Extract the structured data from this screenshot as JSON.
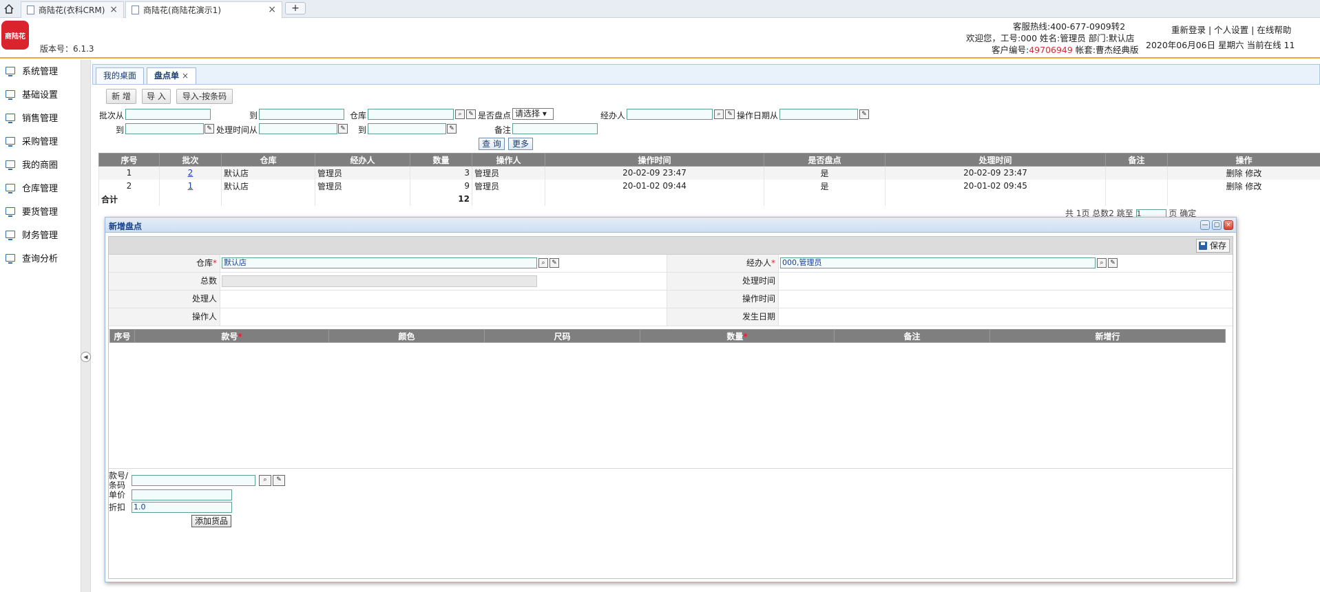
{
  "browser": {
    "tabs": [
      {
        "label": "商陆花(衣科CRM)"
      },
      {
        "label": "商陆花(商陆花演示1)"
      }
    ],
    "new_tab": "+"
  },
  "header": {
    "logo_text": "商陆花",
    "version": "版本号：6.1.3",
    "hotline": "客服热线:400-677-0909转2",
    "welcome": "欢迎您，工号:000 姓名:管理员 部门:默认店",
    "customer_prefix": "客户编号:",
    "customer_no": "49706949",
    "account": "帐套:曹杰经典版",
    "links": "重新登录 | 个人设置 | 在线帮助",
    "date_line": "2020年06月06日 星期六 当前在线 11"
  },
  "sidebar": {
    "items": [
      {
        "label": "系统管理"
      },
      {
        "label": "基础设置"
      },
      {
        "label": "销售管理"
      },
      {
        "label": "采购管理"
      },
      {
        "label": "我的商圈"
      },
      {
        "label": "仓库管理"
      },
      {
        "label": "要货管理"
      },
      {
        "label": "财务管理"
      },
      {
        "label": "查询分析"
      }
    ]
  },
  "content_tabs": [
    {
      "label": "我的桌面"
    },
    {
      "label": "盘点单",
      "close": "×"
    }
  ],
  "toolbar": {
    "add": "新 增",
    "import": "导 入",
    "import_barcode": "导入-按条码"
  },
  "filters": {
    "batch_from": "批次从",
    "to1": "到",
    "warehouse": "仓库",
    "is_check": "是否盘点",
    "is_check_value": "请选择",
    "handler": "经办人",
    "op_date_from": "操作日期从",
    "to2": "到",
    "process_time_from": "处理时间从",
    "to3": "到",
    "remark": "备注",
    "query": "查 询",
    "more": "更多"
  },
  "table": {
    "columns": [
      "序号",
      "批次",
      "仓库",
      "经办人",
      "数量",
      "操作人",
      "操作时间",
      "是否盘点",
      "处理时间",
      "备注",
      "操作"
    ],
    "rows": [
      {
        "no": "1",
        "batch": "2",
        "warehouse": "默认店",
        "handler": "管理员",
        "qty": "3",
        "operator": "管理员",
        "op_time": "20-02-09 23:47",
        "checked": "是",
        "process_time": "20-02-09 23:47",
        "remark": "",
        "actions": "删除 修改"
      },
      {
        "no": "2",
        "batch": "1",
        "warehouse": "默认店",
        "handler": "管理员",
        "qty": "9",
        "operator": "管理员",
        "op_time": "20-01-02 09:44",
        "checked": "是",
        "process_time": "20-01-02 09:45",
        "remark": "",
        "actions": "删除 修改"
      }
    ],
    "total_label": "合计",
    "total_qty": "12"
  },
  "pager": {
    "text": "共 1页 总数2 跳至",
    "page_input": "1",
    "suffix": "页 确定"
  },
  "dialog": {
    "title": "新增盘点",
    "save": "保存",
    "fields": {
      "warehouse_label": "仓库",
      "warehouse_value": "默认店",
      "handler_label": "经办人",
      "handler_value": "000,管理员",
      "total_label": "总数",
      "process_time_label": "处理时间",
      "processor_label": "处理人",
      "op_time_label": "操作时间",
      "operator_label": "操作人",
      "occur_date_label": "发生日期",
      "required_mark": "*"
    },
    "detail_columns": [
      "序号",
      "款号",
      "颜色",
      "尺码",
      "数量",
      "备注",
      "新增行"
    ],
    "bottom": {
      "style_barcode_label": "款号/条码",
      "price_label": "单价",
      "discount_label": "折扣",
      "discount_value": "1.0",
      "add_goods": "添加货品"
    }
  }
}
